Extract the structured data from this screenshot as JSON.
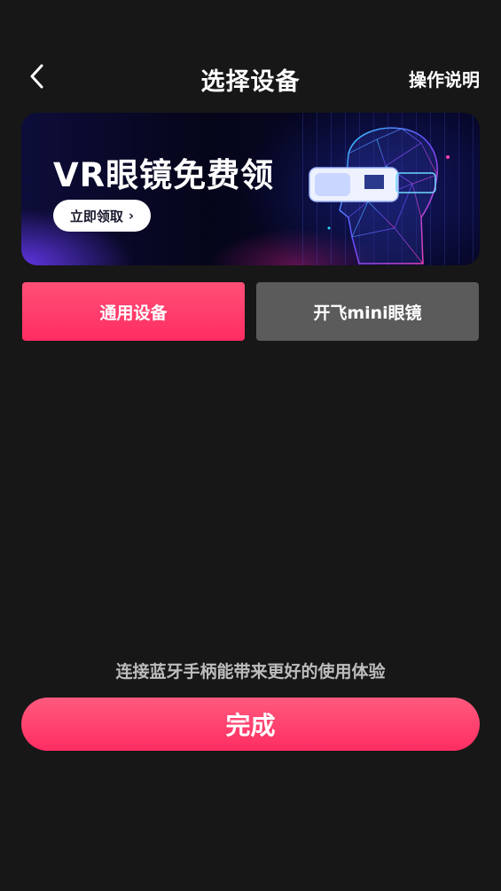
{
  "header": {
    "title": "选择设备",
    "help_label": "操作说明",
    "back_icon": "chevron-left-icon"
  },
  "banner": {
    "title": "VR眼镜免费领",
    "cta_label": "立即领取",
    "cta_icon": "chevron-right-icon"
  },
  "tabs": [
    {
      "label": "通用设备",
      "selected": true
    },
    {
      "label": "开飞mini眼镜",
      "selected": false
    }
  ],
  "hint": "连接蓝牙手柄能带来更好的使用体验",
  "done_label": "完成",
  "colors": {
    "background": "#171717",
    "accent": "#ff2c63",
    "tab_inactive": "#5b5b5b",
    "hint_text": "#bdbdbd"
  }
}
